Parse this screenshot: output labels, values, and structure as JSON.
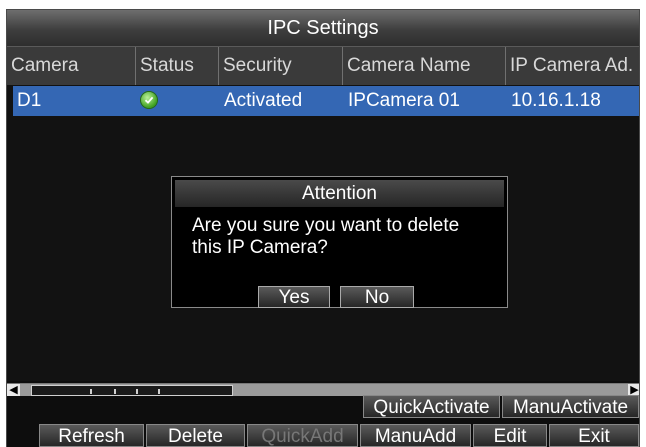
{
  "window": {
    "title": "IPC Settings"
  },
  "table": {
    "columns": [
      "Camera",
      "Status",
      "Security",
      "Camera Name",
      "IP Camera Ad."
    ],
    "rows": [
      {
        "camera": "D1",
        "status_icon": "check-circle-icon",
        "security": "Activated",
        "name": "IPCamera 01",
        "ip": "10.16.1.18"
      }
    ]
  },
  "dialog": {
    "title": "Attention",
    "message": "Are you sure you want to delete this IP Camera?",
    "yes": "Yes",
    "no": "No"
  },
  "buttons": {
    "quick_activate": "QuickActivate",
    "manu_activate": "ManuActivate",
    "refresh": "Refresh",
    "delete": "Delete",
    "quick_add": "QuickAdd",
    "manu_add": "ManuAdd",
    "edit": "Edit",
    "exit": "Exit"
  },
  "colors": {
    "selected_row": "#3467b4",
    "status_ok": "#3fa11e",
    "disabled_text": "#777777"
  }
}
